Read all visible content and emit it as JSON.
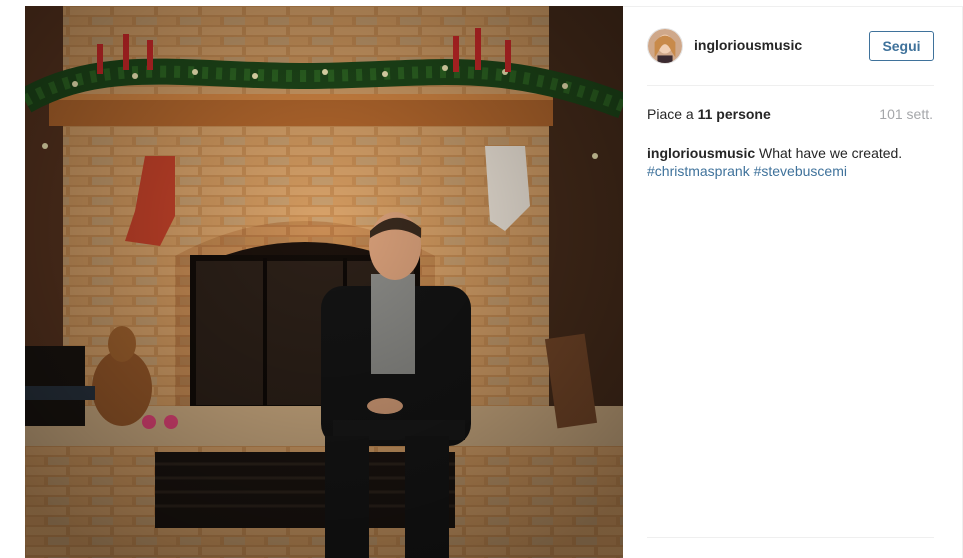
{
  "post": {
    "image_alt": "Cardboard cutout of Steve Buscemi sitting in front of a brick fireplace decorated for Christmas",
    "colors": {
      "link": "#3f729b",
      "text": "#262626",
      "muted": "#a5a7aa",
      "divider": "#efefef"
    }
  },
  "header": {
    "avatar_icon": "user-avatar",
    "username": "ingloriousmusic",
    "follow_label": "Segui"
  },
  "stats": {
    "likes_prefix": "Piace a ",
    "likes_count": "11",
    "likes_suffix": " persone",
    "timestamp": "101 sett."
  },
  "caption": {
    "username": "ingloriousmusic",
    "text": " What have we created.",
    "hashtags": [
      "#christmasprank",
      "#stevebuscemi"
    ]
  }
}
